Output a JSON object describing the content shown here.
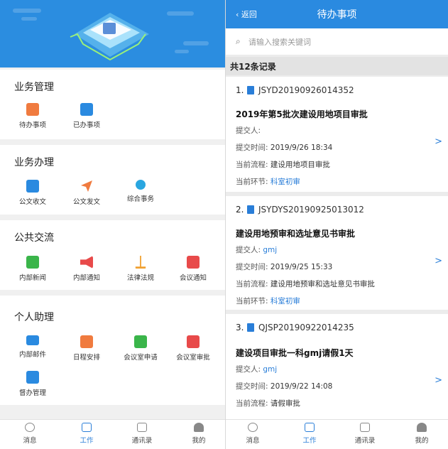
{
  "left": {
    "sections": [
      {
        "title": "业务管理",
        "items": [
          {
            "label": "待办事项",
            "icon": "pending-doc-icon",
            "color": "#f07b3f"
          },
          {
            "label": "已办事项",
            "icon": "done-doc-icon",
            "color": "#2a8ae0"
          }
        ]
      },
      {
        "title": "业务办理",
        "items": [
          {
            "label": "公文收文",
            "icon": "folder-icon",
            "color": "#2a8ae0"
          },
          {
            "label": "公文发文",
            "icon": "send-icon",
            "color": "#f07b3f"
          },
          {
            "label": "综合事务",
            "icon": "bulb-icon",
            "color": "#2aa6e0"
          }
        ]
      },
      {
        "title": "公共交流",
        "items": [
          {
            "label": "内部新闻",
            "icon": "news-icon",
            "color": "#3ab54a"
          },
          {
            "label": "内部通知",
            "icon": "megaphone-icon",
            "color": "#e84a4a"
          },
          {
            "label": "法律法规",
            "icon": "scales-icon",
            "color": "#f0a030"
          },
          {
            "label": "会议通知",
            "icon": "meeting-icon",
            "color": "#e84a4a"
          }
        ]
      },
      {
        "title": "个人助理",
        "items": [
          {
            "label": "内部邮件",
            "icon": "mail-icon",
            "color": "#2a8ae0"
          },
          {
            "label": "日程安排",
            "icon": "calendar-icon",
            "color": "#f07b3f"
          },
          {
            "label": "会议室申请",
            "icon": "room-apply-icon",
            "color": "#3ab54a"
          },
          {
            "label": "会议室审批",
            "icon": "room-approve-icon",
            "color": "#e84a4a"
          },
          {
            "label": "督办管理",
            "icon": "supervise-icon",
            "color": "#2a8ae0"
          }
        ]
      }
    ]
  },
  "tabs": [
    {
      "label": "消息",
      "icon": "chat-icon"
    },
    {
      "label": "工作",
      "icon": "work-icon"
    },
    {
      "label": "通讯录",
      "icon": "contacts-icon"
    },
    {
      "label": "我的",
      "icon": "person-icon"
    }
  ],
  "right": {
    "back": "返回",
    "title": "待办事项",
    "search_placeholder": "请输入搜索关键词",
    "count": "共12条记录",
    "records": [
      {
        "no": "1.",
        "code": "JSYD20190926014352",
        "title": "2019年第5批次建设用地项目审批",
        "submitter_label": "提交人:",
        "submitter": "",
        "time_label": "提交时间:",
        "time": "2019/9/26 18:34",
        "flow_label": "当前流程:",
        "flow": "建设用地项目审批",
        "step_label": "当前环节:",
        "step": "科室初审"
      },
      {
        "no": "2.",
        "code": "JSYDYS20190925013012",
        "title": "建设用地预审和选址意见书审批",
        "submitter_label": "提交人:",
        "submitter": "gmj",
        "time_label": "提交时间:",
        "time": "2019/9/25 15:33",
        "flow_label": "当前流程:",
        "flow": "建设用地预审和选址意见书审批",
        "step_label": "当前环节:",
        "step": "科室初审"
      },
      {
        "no": "3.",
        "code": "QJSP20190922014235",
        "title": "建设项目审批一科gmj请假1天",
        "submitter_label": "提交人:",
        "submitter": "gmj",
        "time_label": "提交时间:",
        "time": "2019/9/22 14:08",
        "flow_label": "当前流程:",
        "flow": "请假审批"
      }
    ],
    "arrow": ">"
  }
}
